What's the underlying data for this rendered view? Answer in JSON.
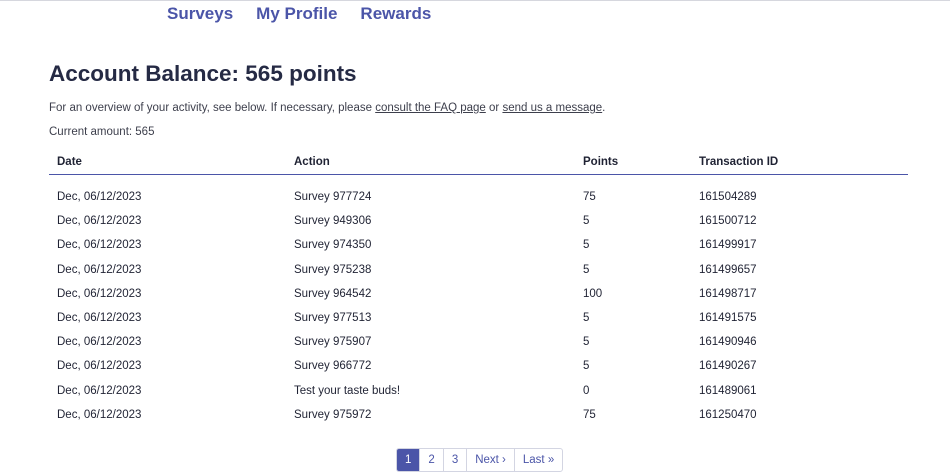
{
  "nav": {
    "items": [
      "Surveys",
      "My Profile",
      "Rewards"
    ]
  },
  "page": {
    "title": "Account Balance: 565 points",
    "intro_prefix": "For an overview of your activity, see below. If necessary, please ",
    "faq_link": "consult the FAQ page",
    "intro_mid": " or ",
    "message_link": "send us a message",
    "intro_suffix": ".",
    "current_amount": "Current amount: 565"
  },
  "table": {
    "headers": {
      "date": "Date",
      "action": "Action",
      "points": "Points",
      "transaction_id": "Transaction ID"
    },
    "rows": [
      {
        "date": "Dec, 06/12/2023",
        "action": "Survey 977724",
        "points": "75",
        "tid": "161504289"
      },
      {
        "date": "Dec, 06/12/2023",
        "action": "Survey 949306",
        "points": "5",
        "tid": "161500712"
      },
      {
        "date": "Dec, 06/12/2023",
        "action": "Survey 974350",
        "points": "5",
        "tid": "161499917"
      },
      {
        "date": "Dec, 06/12/2023",
        "action": "Survey 975238",
        "points": "5",
        "tid": "161499657"
      },
      {
        "date": "Dec, 06/12/2023",
        "action": "Survey 964542",
        "points": "100",
        "tid": "161498717"
      },
      {
        "date": "Dec, 06/12/2023",
        "action": "Survey 977513",
        "points": "5",
        "tid": "161491575"
      },
      {
        "date": "Dec, 06/12/2023",
        "action": "Survey 975907",
        "points": "5",
        "tid": "161490946"
      },
      {
        "date": "Dec, 06/12/2023",
        "action": "Survey 966772",
        "points": "5",
        "tid": "161490267"
      },
      {
        "date": "Dec, 06/12/2023",
        "action": "Test your taste buds!",
        "points": "0",
        "tid": "161489061"
      },
      {
        "date": "Dec, 06/12/2023",
        "action": "Survey 975972",
        "points": "75",
        "tid": "161250470"
      }
    ]
  },
  "pagination": {
    "pages": [
      "1",
      "2",
      "3"
    ],
    "active": "1",
    "next": "Next ›",
    "last": "Last »"
  },
  "colors": {
    "accent": "#4b55a8",
    "title": "#252a44"
  }
}
